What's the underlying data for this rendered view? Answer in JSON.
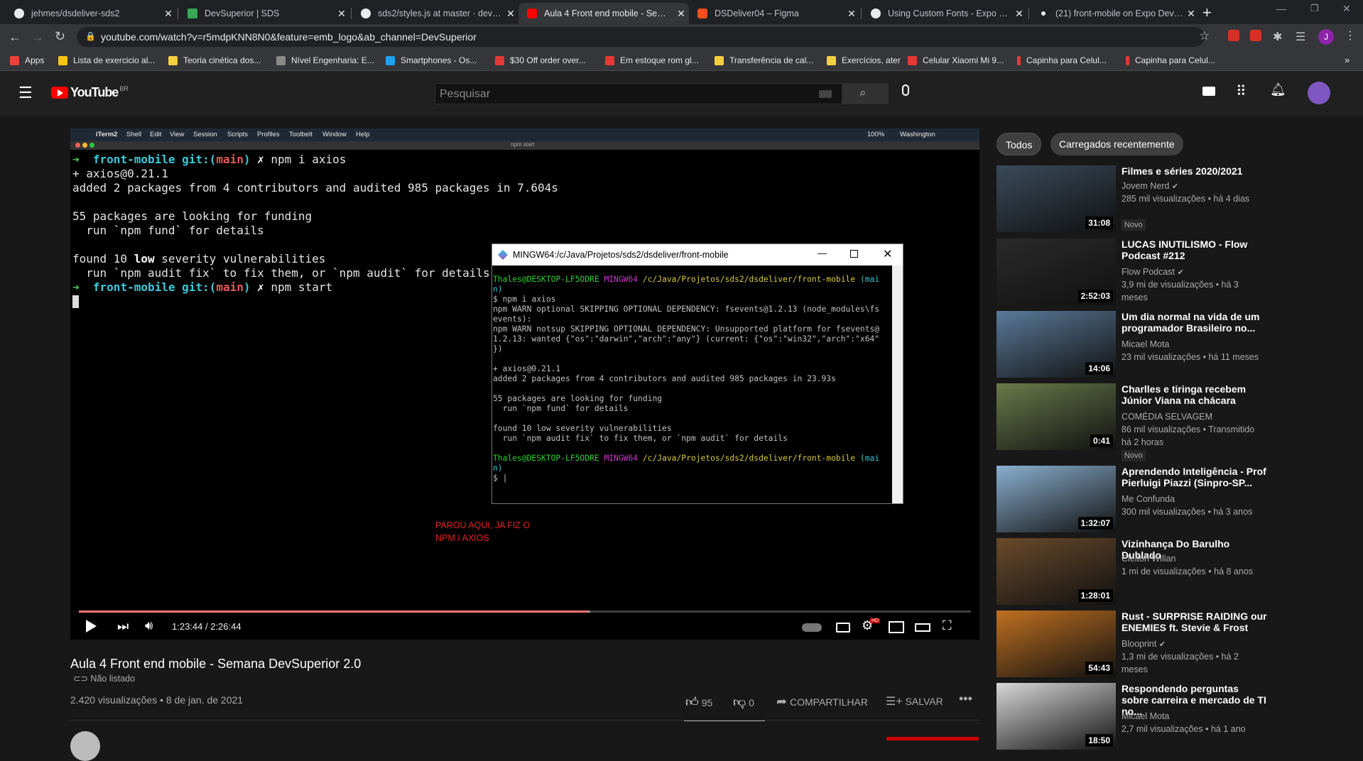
{
  "browser": {
    "tabs": [
      {
        "title": "jehmes/dsdeliver-sds2",
        "icon_color": "#e8eaed"
      },
      {
        "title": "DevSuperior | SDS",
        "icon_color": "#34a853"
      },
      {
        "title": "sds2/styles.js at master · devsuperior",
        "icon_color": "#e8eaed"
      },
      {
        "title": "Aula 4 Front end mobile - Semana DevSuperior",
        "icon_color": "#ff0000"
      },
      {
        "title": "DSDeliver04 – Figma",
        "icon_color": "#f24e1e"
      },
      {
        "title": "Using Custom Fonts - Expo Documentation",
        "icon_color": "#e8eaed"
      },
      {
        "title": "(21) front-mobile on Expo Developers",
        "icon_color": "#e8eaed"
      }
    ],
    "url": "youtube.com/watch?v=r5mdpKNN8N0&feature=emb_logo&ab_channel=DevSuperior",
    "profile_initial": "J",
    "bookmarks": [
      {
        "label": "Apps",
        "icon_color": "#ea4335"
      },
      {
        "label": "Lista de exercicio al...",
        "icon_color": "#f9c513"
      },
      {
        "label": "Teoria cinética dos...",
        "icon_color": "#f4d03f"
      },
      {
        "label": "Nível Engenharia: E...",
        "icon_color": "#888888"
      },
      {
        "label": "Smartphones - Os...",
        "icon_color": "#1da1f2"
      },
      {
        "label": "$30 Off order over...",
        "icon_color": "#e53935"
      },
      {
        "label": "Em estoque rom gl...",
        "icon_color": "#e53935"
      },
      {
        "label": "Transferência de cal...",
        "icon_color": "#f4d03f"
      },
      {
        "label": "Exercícios, ater",
        "icon_color": "#f4d03f"
      },
      {
        "label": "Celular Xiaomi Mi 9...",
        "icon_color": "#e53935"
      },
      {
        "label": "Capinha para Celul...",
        "icon_color": "#e53935"
      },
      {
        "label": "Capinha para Celul...",
        "icon_color": "#e53935"
      }
    ]
  },
  "youtube": {
    "logo_text": "YouTube",
    "logo_country": "BR",
    "search_placeholder": "Pesquisar"
  },
  "player": {
    "mac_menu": [
      "iTerm2",
      "Shell",
      "Edit",
      "View",
      "Session",
      "Scripts",
      "Profiles",
      "Toolbelt",
      "Window",
      "Help"
    ],
    "mac_status": "100%",
    "mac_location": "Washington",
    "iterm_title": "npm start",
    "terminal": {
      "line1_dir": "front-mobile",
      "line1_git": "git:(",
      "line1_branch": "main",
      "line1_git_close": ")",
      "line1_cmd": "npm i axios",
      "line2": "+ axios@0.21.1",
      "line3": "added 2 packages from 4 contributors and audited 985 packages in 7.604s",
      "line4": "55 packages are looking for funding",
      "line5": "  run `npm fund` for details",
      "line6_a": "found 10 ",
      "line6_b": "low",
      "line6_c": " severity vulnerabilities",
      "line7": "  run `npm audit fix` to fix them, or `npm audit` for details",
      "line8_dir": "front-mobile",
      "line8_cmd": "npm start"
    },
    "mingw": {
      "title": "MINGW64:/c/Java/Projetos/sds2/dsdeliver/front-mobile",
      "prompt_user": "Thales@DESKTOP-LF5ODRE",
      "prompt_env": "MINGW64",
      "prompt_path": "/c/Java/Projetos/sds2/dsdeliver/front-mobile",
      "prompt_branch_a": "(mai",
      "prompt_branch_b": "n)",
      "cmd": "$ npm i axios",
      "warn1": "npm WARN optional SKIPPING OPTIONAL DEPENDENCY: fsevents@1.2.13 (node_modules\\fs",
      "warn1b": "events):",
      "warn2": "npm WARN notsup SKIPPING OPTIONAL DEPENDENCY: Unsupported platform for fsevents@",
      "warn2b": "1.2.13: wanted {\"os\":\"darwin\",\"arch\":\"any\"} (current: {\"os\":\"win32\",\"arch\":\"x64\"",
      "warn2c": "})",
      "out1": "+ axios@0.21.1",
      "out2": "added 2 packages from 4 contributors and audited 985 packages in 23.93s",
      "out3": "55 packages are looking for funding",
      "out4": "  run `npm fund` for details",
      "out5": "found 10 low severity vulnerabilities",
      "out6": "  run `npm audit fix` to fix them, or `npm audit` for details",
      "cursor": "$ |"
    },
    "annotation_line1": "PAROU AQUI, JA FIZ O",
    "annotation_line2": "NPM I AXIOS",
    "time_current": "1:23:44",
    "time_total": "2:26:44",
    "progress_fraction": 0.571,
    "buffer_fraction": 0.573
  },
  "video": {
    "title": "Aula 4 Front end mobile - Semana DevSuperior 2.0",
    "visibility": "Não listado",
    "views_date": "2.420 visualizações • 8 de jan. de 2021",
    "likes": "95",
    "dislikes": "0",
    "share_label": "COMPARTILHAR",
    "save_label": "SALVAR"
  },
  "sidebar": {
    "chips": [
      "Todos",
      "Carregados recentemente"
    ],
    "recs": [
      {
        "title": "Filmes e séries 2020/2021",
        "channel": "Jovem Nerd",
        "verified": true,
        "meta": "285 mil visualizações • há 4 dias",
        "badge": "Novo",
        "duration": "31:08",
        "color": "#3a4a5a"
      },
      {
        "title": "LUCAS INUTILISMO - Flow Podcast #212",
        "channel": "Flow Podcast",
        "verified": true,
        "meta": "3,9 mi de visualizações • há 3 meses",
        "badge": "",
        "duration": "2:52:03",
        "color": "#2a2a2a"
      },
      {
        "title": "Um dia normal na vida de um programador Brasileiro no...",
        "channel": "Micael Mota",
        "verified": false,
        "meta": "23 mil visualizações • há 11 meses",
        "badge": "",
        "duration": "14:06",
        "color": "#5a7a9a"
      },
      {
        "title": "Charlles e tiringa recebem Júnior Viana na chácara",
        "channel": "COMÉDIA SELVAGEM",
        "verified": false,
        "meta": "86 mil visualizações • Transmitido há 2 horas",
        "badge": "Novo",
        "duration": "0:41",
        "color": "#6a7a4a"
      },
      {
        "title": "Aprendendo Inteligência - Prof Pierluigi Piazzi (Sinpro-SP...",
        "channel": "Me Confunda",
        "verified": false,
        "meta": "300 mil visualizações • há 3 anos",
        "badge": "",
        "duration": "1:32:07",
        "color": "#8ab0d0"
      },
      {
        "title": "Vizinhança Do Barulho Dublado",
        "channel": "Cleiton Willan",
        "verified": false,
        "meta": "1 mi de visualizações • há 8 anos",
        "badge": "",
        "duration": "1:28:01",
        "color": "#6a4a2a"
      },
      {
        "title": "Rust - SURPRISE RAIDING our ENEMIES ft. Stevie & Frost",
        "channel": "Blooprint",
        "verified": true,
        "meta": "1,3 mi de visualizações • há 2 meses",
        "badge": "",
        "duration": "54:43",
        "color": "#c07020"
      },
      {
        "title": "Respondendo perguntas sobre carreira e mercado de TI no...",
        "channel": "Micael Mota",
        "verified": false,
        "meta": "2,7 mil visualizações • há 1 ano",
        "badge": "",
        "duration": "18:50",
        "color": "#d8d8d8"
      }
    ]
  }
}
